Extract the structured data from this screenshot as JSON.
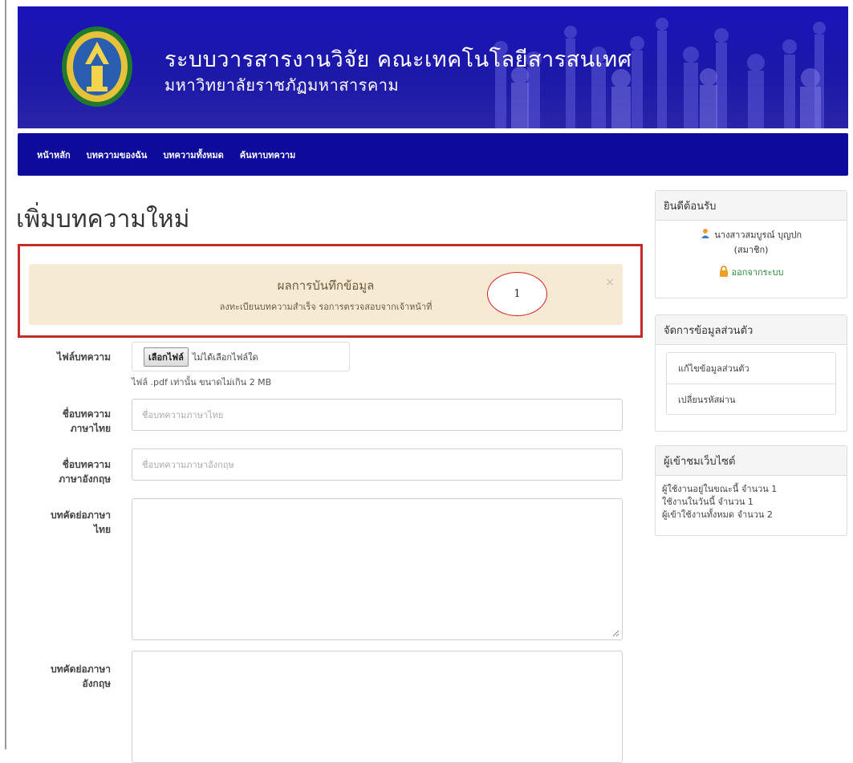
{
  "header": {
    "title": "ระบบวารสารงานวิจัย คณะเทคโนโลยีสารสนเทศ",
    "subtitle": "มหาวิทยาลัยราชภัฏมหาสารคาม",
    "colors": {
      "banner": "#1a14b8",
      "navbar": "#0d0a9c"
    }
  },
  "nav": {
    "items": [
      {
        "label": "หน้าหลัก"
      },
      {
        "label": "บทความของฉัน"
      },
      {
        "label": "บทความทั้งหมด"
      },
      {
        "label": "ค้นหาบทความ"
      }
    ]
  },
  "page": {
    "title": "เพิ่มบทความใหม่"
  },
  "alert": {
    "heading": "ผลการบันทึกข้อมูล",
    "body": "ลงทะเบียนบทความสำเร็จ รอการตรวจสอบจากเจ้าหน้าที่",
    "close": "×",
    "highlight_color": "#c42b2b"
  },
  "annotation": {
    "number": "1"
  },
  "form": {
    "file": {
      "label": "ไฟล์บทความ",
      "button": "เลือกไฟล์",
      "status": "ไม่ได้เลือกไฟล์ใด",
      "help": "ไฟล์ .pdf เท่านั้น ขนาดไม่เกิน 2 MB"
    },
    "title_th": {
      "label_line1": "ชื่อบทความ",
      "label_line2": "ภาษาไทย",
      "placeholder": "ชื่อบทความภาษาไทย"
    },
    "title_en": {
      "label_line1": "ชื่อบทความ",
      "label_line2": "ภาษาอังกฤษ",
      "placeholder": "ชื่อบทความภาษาอังกฤษ"
    },
    "abstract_th": {
      "label_line1": "บทคัดย่อภาษา",
      "label_line2": "ไทย"
    },
    "abstract_en": {
      "label_line1": "บทคัดย่อภาษา",
      "label_line2": "อังกฤษ"
    }
  },
  "sidebar": {
    "welcome": {
      "heading": "ยินดีต้อนรับ",
      "user_name": "นางสาวสมบูรณ์ บุญปก",
      "role": "(สมาชิก)",
      "logout": "ออกจากระบบ",
      "user_icon": "user-icon",
      "lock_icon": "lock-icon"
    },
    "profile": {
      "heading": "จัดการข้อมูลส่วนตัว",
      "items": [
        {
          "label": "แก้ไขข้อมูลส่วนตัว"
        },
        {
          "label": "เปลี่ยนรหัสผ่าน"
        }
      ]
    },
    "visitors": {
      "heading": "ผู้เข้าชมเว็บไซต์",
      "online": "ผู้ใช้งานอยู่ในขณะนี้ จำนวน 1",
      "today": "ใช้งานในวันนี้ จำนวน 1",
      "total": "ผู้เข้าใช้งานทั้งหมด จำนวน 2"
    }
  }
}
